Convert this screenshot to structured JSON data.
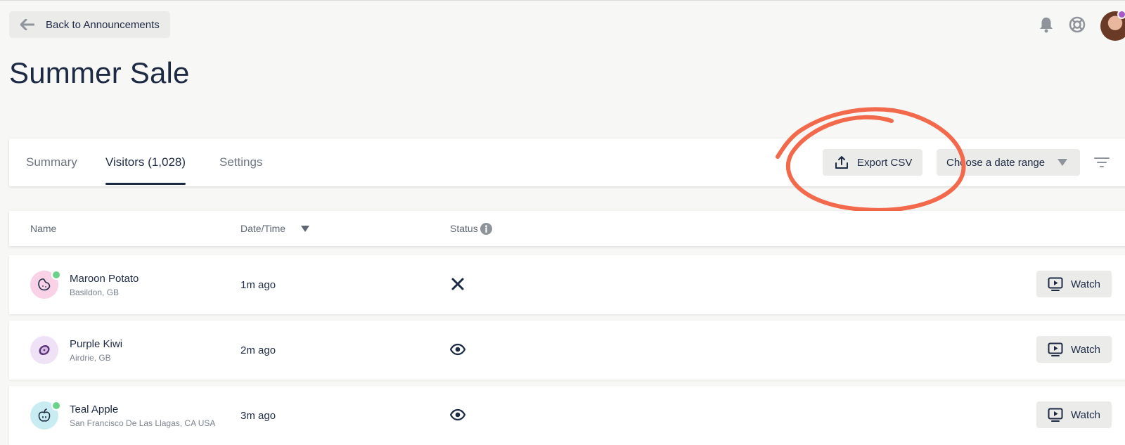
{
  "header": {
    "back_label": "Back to Announcements",
    "title": "Summer Sale"
  },
  "tabs": [
    {
      "label": "Summary",
      "active": false
    },
    {
      "label": "Visitors (1,028)",
      "active": true
    },
    {
      "label": "Settings",
      "active": false
    }
  ],
  "toolbar": {
    "export_label": "Export CSV",
    "date_range_label": "Choose a date range"
  },
  "table": {
    "columns": [
      "Name",
      "Date/Time",
      "Status"
    ],
    "rows": [
      {
        "name": "Maroon Potato",
        "location": "Basildon, GB",
        "time": "1m ago",
        "status": "not-viewed",
        "online": true,
        "avatar_icon": "potato-icon",
        "avatar_bg": "#f9d2e8",
        "watch_label": "Watch"
      },
      {
        "name": "Purple Kiwi",
        "location": "Airdrie, GB",
        "time": "2m ago",
        "status": "viewed",
        "online": false,
        "avatar_icon": "kiwi-icon",
        "avatar_bg": "#efe1f6",
        "watch_label": "Watch"
      },
      {
        "name": "Teal Apple",
        "location": "San Francisco De Las Llagas, CA USA",
        "time": "3m ago",
        "status": "viewed",
        "online": true,
        "avatar_icon": "apple-icon",
        "avatar_bg": "#c9ecf2",
        "watch_label": "Watch"
      }
    ]
  },
  "colors": {
    "accent": "#1d2a44",
    "annotation": "#f26a4b",
    "online": "#6bd28b"
  }
}
